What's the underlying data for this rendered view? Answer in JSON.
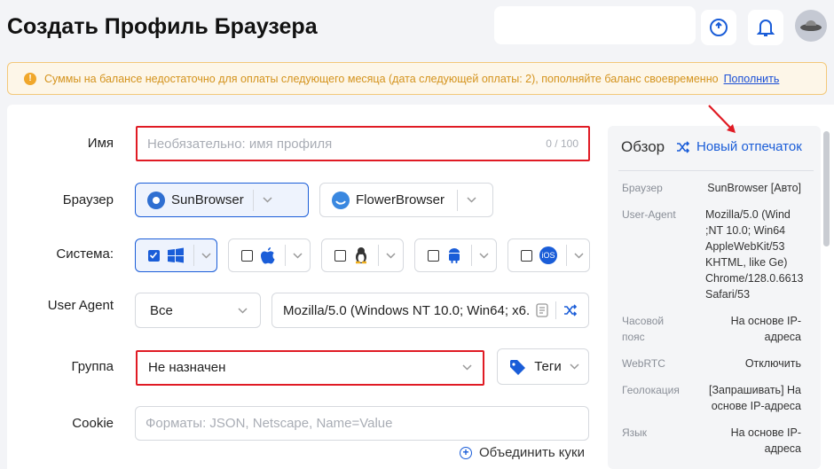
{
  "header": {
    "title": "Создать Профиль Браузера"
  },
  "warning": {
    "text": "Суммы на балансе недостаточно для оплаты следующего месяца (дата следующей оплаты: 2), пополняйте баланс своевременно",
    "link": "Пополнить"
  },
  "form": {
    "name": {
      "label": "Имя",
      "placeholder": "Необязательно: имя профиля",
      "counter": "0 / 100"
    },
    "browser": {
      "label": "Браузер",
      "options": [
        "SunBrowser",
        "FlowerBrowser"
      ],
      "selected": "SunBrowser"
    },
    "system": {
      "label": "Система:",
      "options": [
        "windows",
        "apple",
        "linux",
        "android",
        "iOS"
      ],
      "selected": "windows",
      "ios_text": "iOS"
    },
    "user_agent": {
      "label": "User Agent",
      "filter": "Все",
      "value": "Mozilla/5.0 (Windows NT 10.0; Win64; x6..."
    },
    "group": {
      "label": "Группа",
      "value": "Не назначен",
      "tags_label": "Теги"
    },
    "cookie": {
      "label": "Cookie",
      "placeholder": "Форматы: JSON, Netscape, Name=Value",
      "merge_label": "Объединить куки"
    }
  },
  "overview": {
    "title": "Обзор",
    "new_fingerprint": "Новый отпечаток",
    "rows": [
      {
        "key": "Браузер",
        "value": "SunBrowser [Авто]"
      },
      {
        "key": "User-Agent",
        "value": "Mozilla/5.0 (Wind\nNT 10.0; Win64;\nAppleWebKit/53\n(KHTML, like Ge\nChrome/128.0.6613\nSafari/53"
      },
      {
        "key": "Часовой\nпояс",
        "value": "На основе IP-\nадреса"
      },
      {
        "key": "WebRTC",
        "value": "Отключить"
      },
      {
        "key": "Геолокация",
        "value": "[Запрашивать] На\nоснове IP-адреса"
      },
      {
        "key": "Язык",
        "value": "На основе IP-\nадреса"
      }
    ]
  },
  "colors": {
    "accent": "#1a5dd8",
    "highlight": "#e01b24",
    "warning": "#d4931d"
  }
}
